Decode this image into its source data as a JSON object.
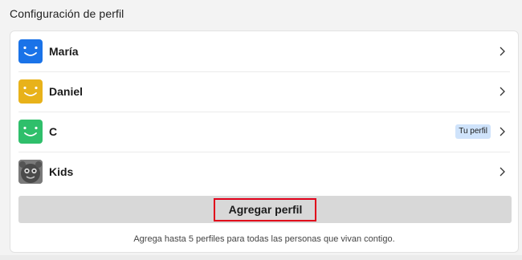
{
  "page": {
    "title": "Configuración de perfil"
  },
  "profiles": [
    {
      "name": "María",
      "avatar_color": "#1a73e8",
      "avatar_icon": "smile-face-icon",
      "current": false
    },
    {
      "name": "Daniel",
      "avatar_color": "#e8b21a",
      "avatar_icon": "smile-face-icon",
      "current": false
    },
    {
      "name": "C",
      "avatar_color": "#2fbf6b",
      "avatar_icon": "smile-face-icon",
      "current": true,
      "badge": "Tu perfil"
    },
    {
      "name": "Kids",
      "avatar_color": "#6b6b6b",
      "avatar_icon": "kids-character-icon",
      "current": false
    }
  ],
  "actions": {
    "add_profile_label": "Agregar perfil",
    "helper_text": "Agrega hasta 5 perfiles para todas las personas que vivan contigo."
  },
  "colors": {
    "background": "#f3f3f3",
    "card": "#ffffff",
    "button_bg": "#d8d8d8",
    "highlight_border": "#e0001a",
    "badge_bg": "#cfe3fb"
  }
}
